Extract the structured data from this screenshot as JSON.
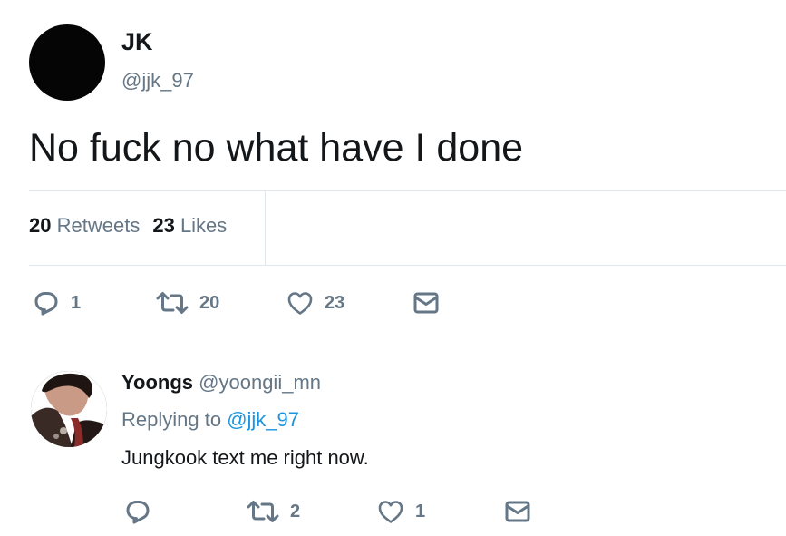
{
  "main_tweet": {
    "name": "JK",
    "handle": "@jjk_97",
    "text": "No fuck no what have I done",
    "stats": {
      "retweets_count": "20",
      "retweets_label": "Retweets",
      "likes_count": "23",
      "likes_label": "Likes"
    },
    "actions": {
      "reply_count": "1",
      "retweet_count": "20",
      "like_count": "23"
    }
  },
  "reply_tweet": {
    "name": "Yoongs",
    "handle": "@yoongii_mn",
    "replying_prefix": "Replying to",
    "replying_to": "@jjk_97",
    "text": "Jungkook text me right now.",
    "actions": {
      "retweet_count": "2",
      "like_count": "1"
    }
  },
  "icons": {
    "reply": "reply-icon",
    "retweet": "retweet-icon",
    "like": "heart-icon",
    "direct_message": "envelope-icon"
  },
  "colors": {
    "text_primary": "#14171a",
    "text_secondary": "#657786",
    "link": "#1b95e0",
    "divider": "#e1e8ed"
  }
}
